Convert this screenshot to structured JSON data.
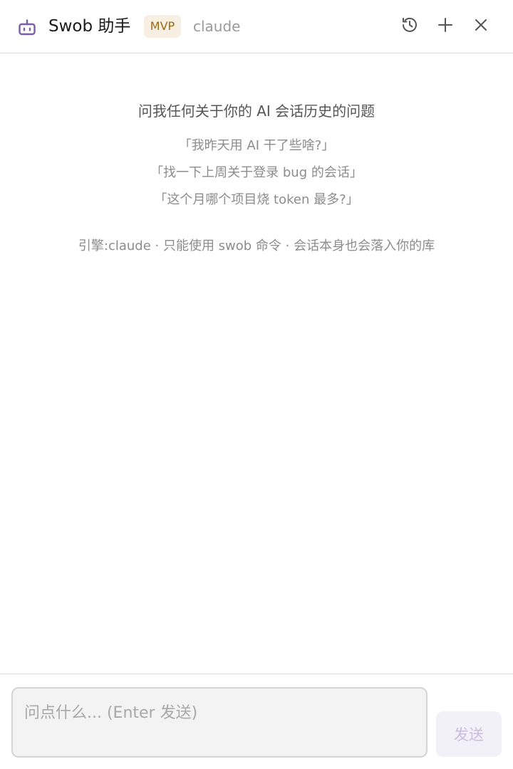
{
  "header": {
    "title": "Swob 助手",
    "badge": "MVP",
    "engine": "claude",
    "icons": {
      "logo": "robot-icon",
      "history": "history-icon",
      "new": "plus-icon",
      "close": "close-icon"
    }
  },
  "empty_state": {
    "title": "问我任何关于你的 AI 会话历史的问题",
    "examples": [
      "「我昨天用 AI 干了些啥?」",
      "「找一下上周关于登录 bug 的会话」",
      "「这个月哪个项目烧 token 最多?」"
    ],
    "note": "引擎:claude · 只能使用 swob 命令 · 会话本身也会落入你的库"
  },
  "composer": {
    "placeholder": "问点什么... (Enter 发送)",
    "value": "",
    "send_label": "发送"
  },
  "colors": {
    "accent": "#7b5ea7",
    "badge_bg": "#f7efe1",
    "badge_text": "#9a6b14",
    "send_disabled_bg": "#f3f1f8",
    "send_disabled_text": "#c9bce0"
  }
}
